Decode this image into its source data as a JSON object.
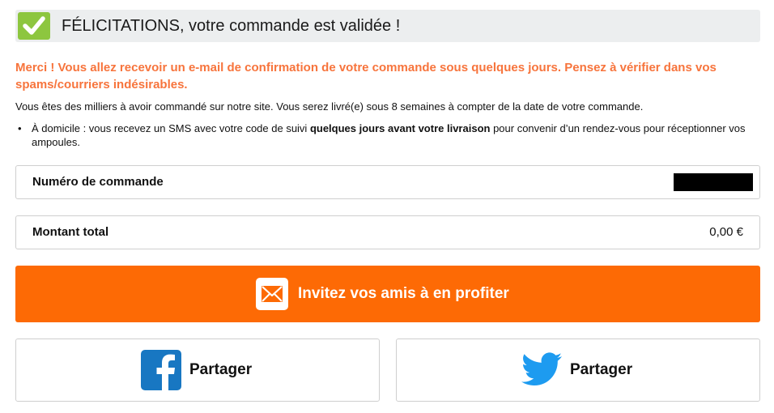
{
  "banner": {
    "title": "FÉLICITATIONS, votre commande est validée !",
    "icon": "check-icon"
  },
  "merci": "Merci ! Vous allez recevoir un e-mail de confirmation de votre commande sous quelques jours. Pensez à vérifier dans vos spams/courriers indésirables.",
  "info": "Vous êtes des milliers à avoir commandé sur notre site. Vous serez livré(e) sous 8 semaines à compter de la date de votre commande.",
  "delivery": {
    "prefix": "À domicile : vous recevez un SMS avec votre code de suivi ",
    "bold": "quelques jours avant votre livraison",
    "suffix": " pour convenir d’un rendez-vous pour réceptionner vos ampoules."
  },
  "order": {
    "number_label": "Numéro de commande",
    "total_label": "Montant total",
    "total_value": "0,00 €"
  },
  "invite": {
    "label": "Invitez vos amis à en profiter",
    "icon": "mail-icon"
  },
  "share": {
    "facebook_label": "Partager",
    "twitter_label": "Partager"
  },
  "colors": {
    "accent": "#fd6a05",
    "merci_text": "#f7743c",
    "check": "#8dc63f",
    "facebook": "#1877c2",
    "twitter": "#1d9bf0"
  }
}
